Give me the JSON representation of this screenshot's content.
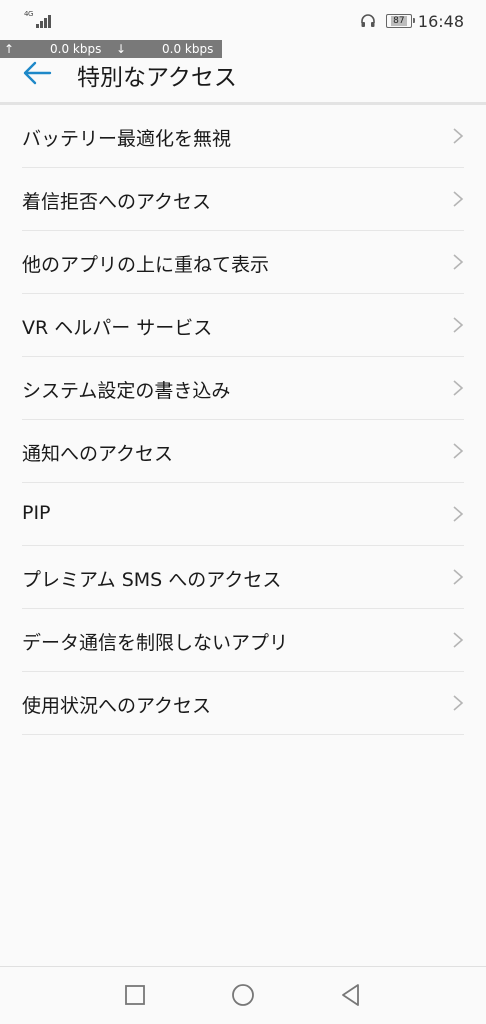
{
  "status_bar": {
    "network": "4G",
    "battery": "87",
    "time": "16:48"
  },
  "speed": {
    "up_arrow": "↑",
    "up": "0.0 kbps",
    "down_arrow": "↓",
    "down": "0.0 kbps"
  },
  "header": {
    "title": "特別なアクセス"
  },
  "items": [
    {
      "label": "バッテリー最適化を無視"
    },
    {
      "label": "着信拒否へのアクセス"
    },
    {
      "label": "他のアプリの上に重ねて表示"
    },
    {
      "label": "VR ヘルパー サービス"
    },
    {
      "label": "システム設定の書き込み"
    },
    {
      "label": "通知へのアクセス"
    },
    {
      "label": "PIP"
    },
    {
      "label": "プレミアム SMS へのアクセス"
    },
    {
      "label": "データ通信を制限しないアプリ"
    },
    {
      "label": "使用状況へのアクセス"
    }
  ],
  "colors": {
    "accent": "#1e88c8",
    "background": "#fafafa",
    "divider": "#e6e6e6",
    "chevron": "#b5b5b5"
  },
  "icons": {
    "back": "arrow-left-icon",
    "chevron": "chevron-right-icon",
    "nav_recent": "square-icon",
    "nav_home": "circle-icon",
    "nav_back": "triangle-back-icon"
  }
}
